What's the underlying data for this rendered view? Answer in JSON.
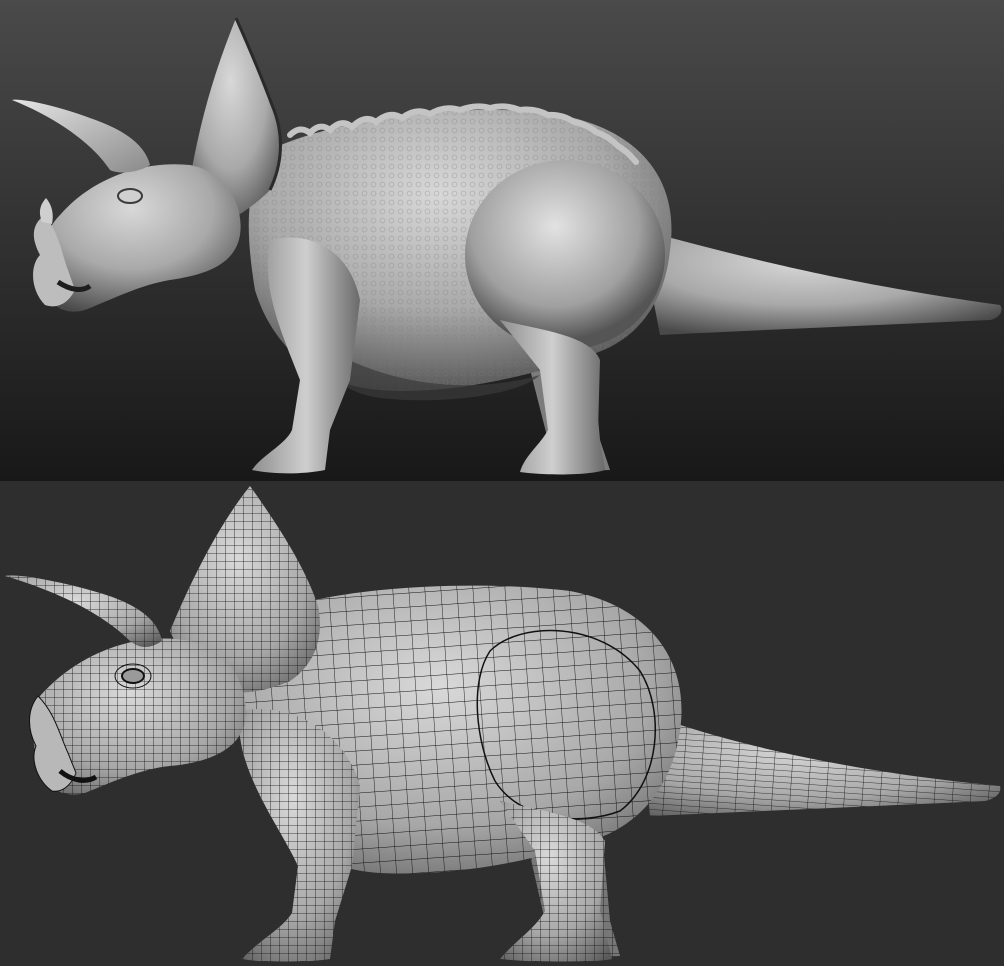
{
  "image": {
    "description_type": "render-comparison",
    "panels": [
      {
        "id": "top",
        "content": "sculpted-triceratops",
        "shading": "clay-detail"
      },
      {
        "id": "bottom",
        "content": "triceratops-base-mesh",
        "shading": "wireframe-quads"
      }
    ],
    "colors": {
      "top_bg_light": "#4a4a4a",
      "top_bg_dark": "#1b1b1b",
      "bottom_bg": "#2e2e2e",
      "clay_highlight": "#d6d6d6",
      "clay_mid": "#9a9a9a",
      "clay_shadow": "#3c3c3c",
      "wire": "#111111"
    }
  }
}
